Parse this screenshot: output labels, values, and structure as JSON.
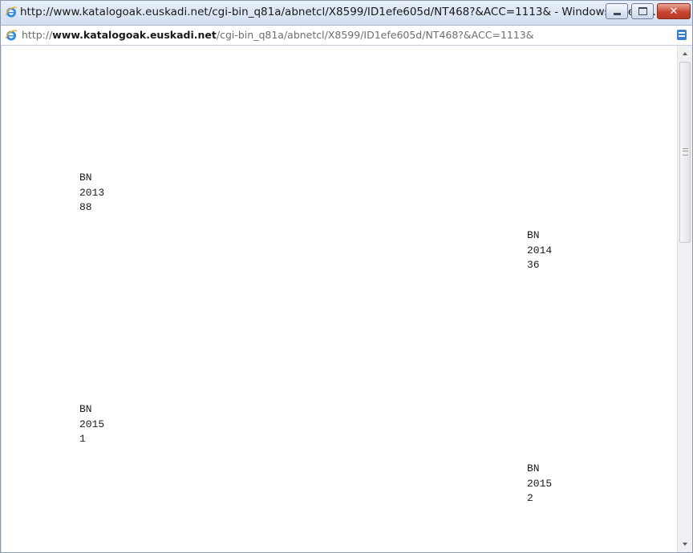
{
  "window": {
    "title": "http://www.katalogoak.euskadi.net/cgi-bin_q81a/abnetcl/X8599/ID1efe605d/NT468?&ACC=1113& - Windows Intern...",
    "icon": "internet-explorer-icon"
  },
  "address_bar": {
    "url_prefix": "http://",
    "url_domain": "www.katalogoak.euskadi.net",
    "url_path": "/cgi-bin_q81a/abnetcl/X8599/ID1efe605d/NT468?&ACC=1113&",
    "icon": "internet-explorer-icon",
    "right_icon": "compatibility-view-icon"
  },
  "records": [
    {
      "code": "BN",
      "year": "2013",
      "number": "88"
    },
    {
      "code": "BN",
      "year": "2014",
      "number": "36"
    },
    {
      "code": "BN",
      "year": "2015",
      "number": "1"
    },
    {
      "code": "BN",
      "year": "2015",
      "number": "2"
    }
  ],
  "colors": {
    "title_bar": "#d3dff0",
    "close_button": "#c74530",
    "text": "#1c1c1c"
  }
}
